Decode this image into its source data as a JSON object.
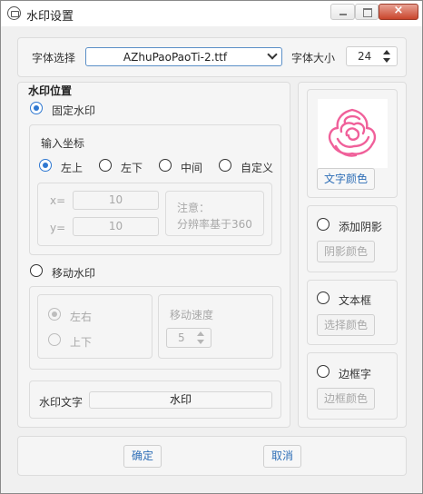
{
  "window": {
    "title": "水印设置",
    "close_label": "×"
  },
  "font": {
    "label": "字体选择",
    "selected": "AZhuPaoPaoTi-2.ttf",
    "size_label": "字体大小",
    "size_value": "24"
  },
  "position": {
    "legend": "水印位置",
    "fixed_label": "固定水印",
    "coord_legend": "输入坐标",
    "radios": [
      "左上",
      "左下",
      "中间",
      "自定义"
    ],
    "x_label": "x=",
    "x_value": "10",
    "y_label": "y=",
    "y_value": "10",
    "note_line1": "注意：",
    "note_line2": "分辨率基于360",
    "moving_label": "移动水印",
    "move_lr": "左右",
    "move_ud": "上下",
    "speed_label": "移动速度",
    "speed_value": "5"
  },
  "text": {
    "label": "水印文字",
    "value": "水印"
  },
  "style": {
    "text_color_button": "文字颜色",
    "shadow_label": "添加阴影",
    "shadow_color_button": "阴影颜色",
    "textbox_label": "文本框",
    "textbox_color_button": "选择颜色",
    "border_label": "边框字",
    "border_color_button": "边框颜色",
    "preview_color": "#f0609a"
  },
  "footer": {
    "ok": "确定",
    "cancel": "取消"
  }
}
